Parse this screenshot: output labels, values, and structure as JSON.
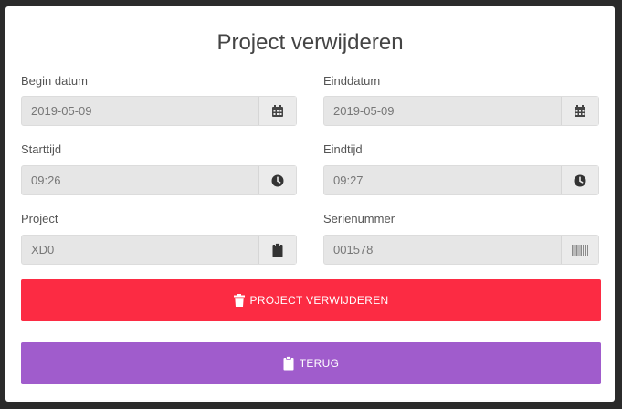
{
  "dialog": {
    "title": "Project verwijderen"
  },
  "fields": {
    "begin_datum": {
      "label": "Begin datum",
      "value": "2019-05-09",
      "icon": "calendar-icon"
    },
    "einddatum": {
      "label": "Einddatum",
      "value": "2019-05-09",
      "icon": "calendar-icon"
    },
    "starttijd": {
      "label": "Starttijd",
      "value": "09:26",
      "icon": "clock-icon"
    },
    "eindtijd": {
      "label": "Eindtijd",
      "value": "09:27",
      "icon": "clock-icon"
    },
    "project": {
      "label": "Project",
      "value": "XD0",
      "icon": "clipboard-icon"
    },
    "serienummer": {
      "label": "Serienummer",
      "value": "001578",
      "icon": "barcode-icon"
    }
  },
  "buttons": {
    "delete": {
      "label": "PROJECT VERWIJDEREN",
      "color": "#fc2b43",
      "icon": "trash-icon"
    },
    "back": {
      "label": "TERUG",
      "color": "#a05ccc",
      "icon": "clipboard-icon"
    }
  }
}
